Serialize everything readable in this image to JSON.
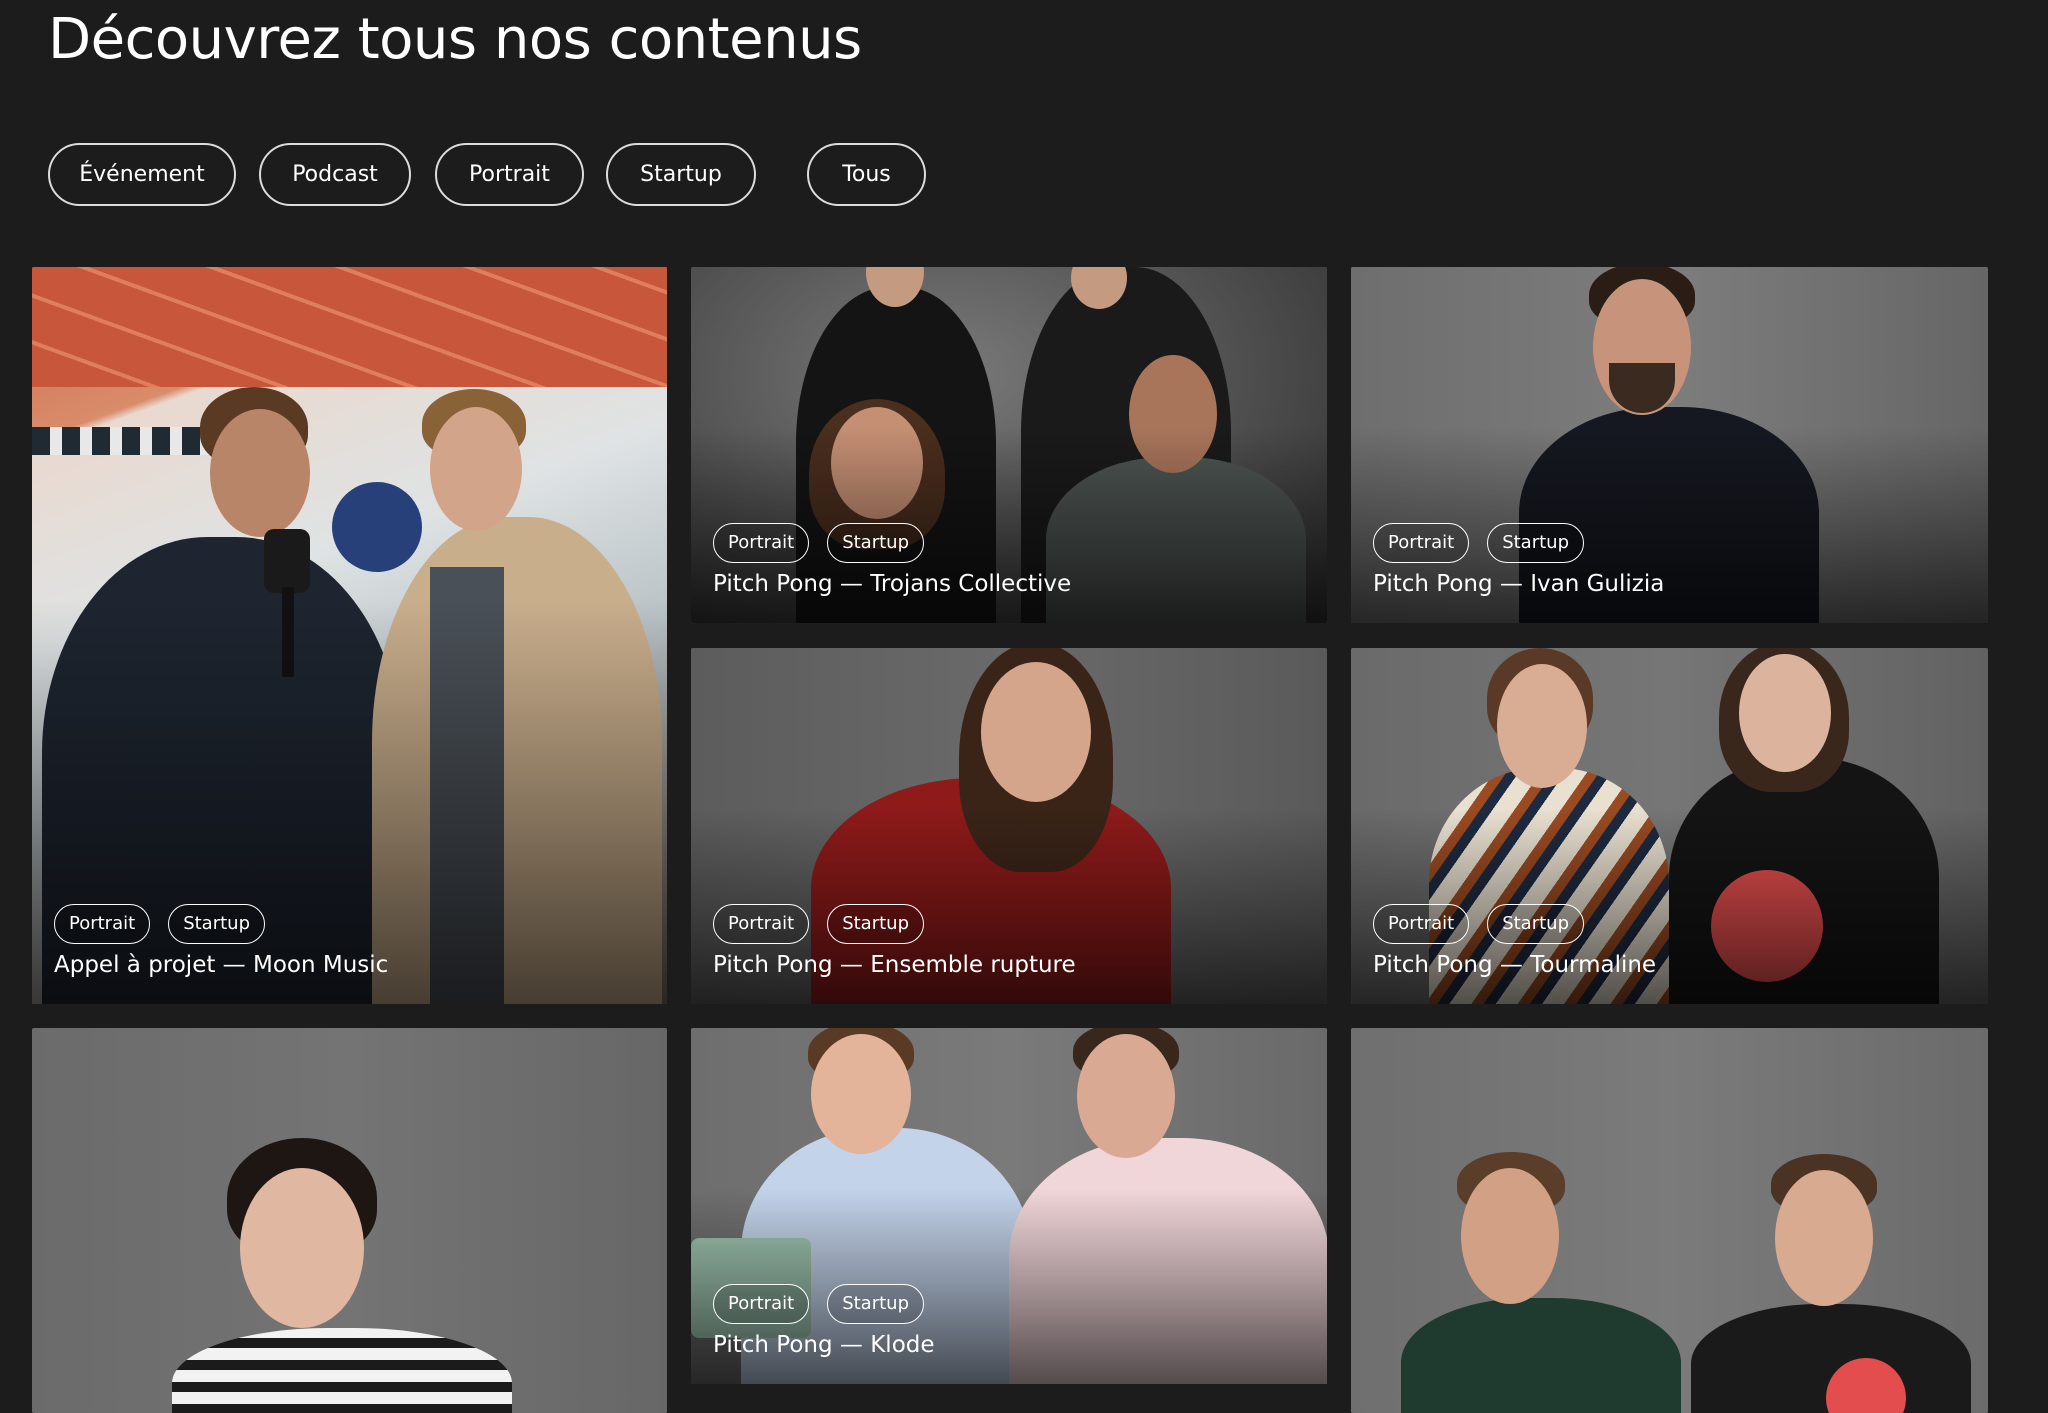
{
  "page": {
    "title": "Découvrez tous nos contenus"
  },
  "filters": [
    {
      "label": "Événement"
    },
    {
      "label": "Podcast"
    },
    {
      "label": "Portrait"
    },
    {
      "label": "Startup"
    },
    {
      "label": "Tous"
    }
  ],
  "cards": [
    {
      "title": "Appel à projet — Moon Music",
      "tags": [
        "Portrait",
        "Startup"
      ],
      "image": "interview-photo"
    },
    {
      "title": "Pitch Pong — Trojans Collective",
      "tags": [
        "Portrait",
        "Startup"
      ],
      "image": "group-photo"
    },
    {
      "title": "Pitch Pong — Ivan Gulizia",
      "tags": [
        "Portrait",
        "Startup"
      ],
      "image": "portrait-photo"
    },
    {
      "title": "Pitch Pong — Ensemble rupture",
      "tags": [
        "Portrait",
        "Startup"
      ],
      "image": "portrait-photo"
    },
    {
      "title": "Pitch Pong — Tourmaline",
      "tags": [
        "Portrait",
        "Startup"
      ],
      "image": "duo-photo"
    },
    {
      "title": "",
      "tags": [],
      "image": "portrait-photo"
    },
    {
      "title": "Pitch Pong — Klode",
      "tags": [
        "Portrait",
        "Startup"
      ],
      "image": "duo-photo"
    },
    {
      "title": "",
      "tags": [],
      "image": "duo-photo"
    }
  ],
  "colors": {
    "background": "#1c1c1c",
    "text": "#ffffff",
    "pill_border": "#dcdcdc",
    "studio_gray": "#6b6b6b"
  }
}
